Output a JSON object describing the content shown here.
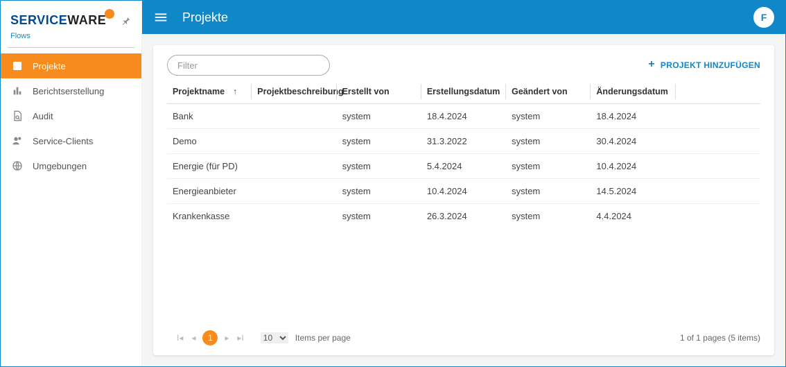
{
  "brand": {
    "part1": "SERVICE",
    "part2": "WARE",
    "sub": "Flows"
  },
  "sidebar": {
    "items": [
      {
        "label": "Projekte"
      },
      {
        "label": "Berichtserstellung"
      },
      {
        "label": "Audit"
      },
      {
        "label": "Service-Clients"
      },
      {
        "label": "Umgebungen"
      }
    ]
  },
  "header": {
    "title": "Projekte",
    "user_initial": "F"
  },
  "toolbar": {
    "filter_placeholder": "Filter",
    "add_label": "PROJEKT HINZUFÜGEN"
  },
  "table": {
    "columns": [
      "Projektname",
      "Projektbeschreibung",
      "Erstellt von",
      "Erstellungsdatum",
      "Geändert von",
      "Änderungsdatum",
      ""
    ],
    "sort_column": 0,
    "sort_dir": "asc",
    "rows": [
      {
        "name": "Bank",
        "desc": "",
        "created_by": "system",
        "created_at": "18.4.2024",
        "modified_by": "system",
        "modified_at": "18.4.2024"
      },
      {
        "name": "Demo",
        "desc": "",
        "created_by": "system",
        "created_at": "31.3.2022",
        "modified_by": "system",
        "modified_at": "30.4.2024"
      },
      {
        "name": "Energie (für PD)",
        "desc": "",
        "created_by": "system",
        "created_at": "5.4.2024",
        "modified_by": "system",
        "modified_at": "10.4.2024"
      },
      {
        "name": "Energieanbieter",
        "desc": "",
        "created_by": "system",
        "created_at": "10.4.2024",
        "modified_by": "system",
        "modified_at": "14.5.2024"
      },
      {
        "name": "Krankenkasse",
        "desc": "",
        "created_by": "system",
        "created_at": "26.3.2024",
        "modified_by": "system",
        "modified_at": "4.4.2024"
      }
    ]
  },
  "pager": {
    "page": "1",
    "page_size": "10",
    "items_per_page_label": "Items per page",
    "summary": "1 of 1 pages (5 items)"
  }
}
